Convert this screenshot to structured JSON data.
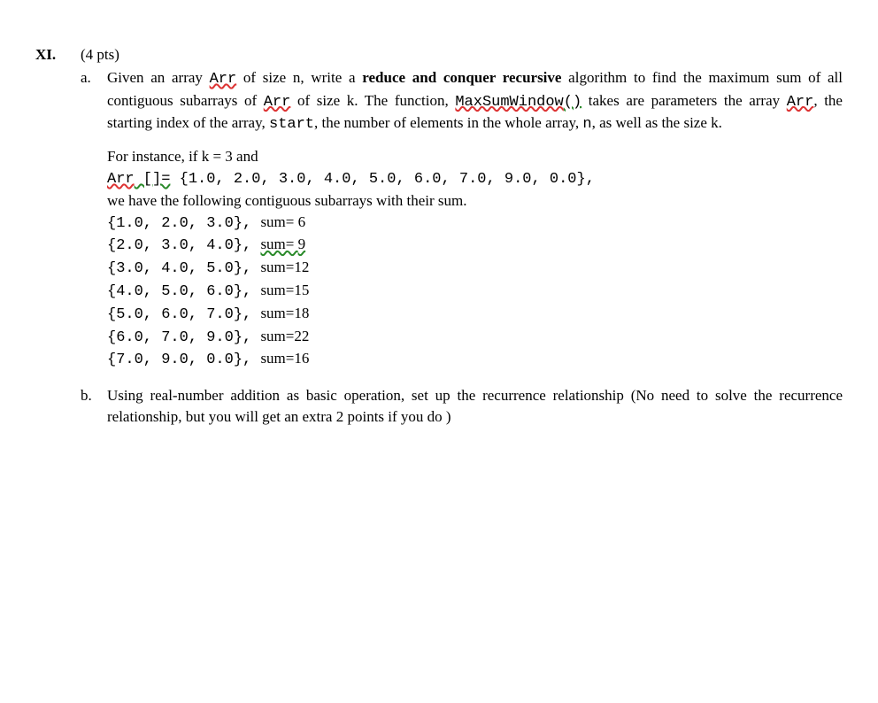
{
  "q_number": "XI.",
  "points": "(4 pts)",
  "a_marker": "a.",
  "b_marker": "b.",
  "a_text": {
    "p1_pre": "Given an array ",
    "arr": "Arr",
    "p1_mid1": " of size n, write a ",
    "bold1": "reduce and conquer recursive",
    "p1_mid2": " algorithm to find the maximum sum of all contiguous subarrays of ",
    "p1_mid3": " of size k. The function, ",
    "func": "MaxSumWindow",
    "paren": "()",
    "p1_mid4": " takes are parameters the array ",
    "p1_mid5": ", the starting index of the array, ",
    "start_code": "start",
    "p1_mid6": ", the number of elements in the whole array, ",
    "n_code": "n",
    "p1_end": ", as well as the size k."
  },
  "example": {
    "intro": "For instance, if k = 3 and",
    "arr_decl_pre": "Arr",
    "arr_decl_eq": " []=",
    "arr_decl_val": "  {1.0, 2.0, 3.0, 4.0, 5.0, 6.0, 7.0, 9.0, 0.0},",
    "following": "we have the following contiguous subarrays with their sum.",
    "lines": [
      {
        "arr": "{1.0, 2.0, 3.0}",
        "sep": ", ",
        "sum_pre": "sum= ",
        "sum_val": "6",
        "squiggle": false
      },
      {
        "arr": "{2.0, 3.0, 4.0}",
        "sep": ", ",
        "sum_pre": "sum= ",
        "sum_val": "9",
        "squiggle": true
      },
      {
        "arr": "{3.0, 4.0, 5.0}",
        "sep": ", ",
        "sum_pre": "sum=",
        "sum_val": "12",
        "squiggle": false
      },
      {
        "arr": "{4.0, 5.0, 6.0}",
        "sep": ", ",
        "sum_pre": "sum=",
        "sum_val": "15",
        "squiggle": false
      },
      {
        "arr": "{5.0, 6.0, 7.0}",
        "sep": ", ",
        "sum_pre": "sum=",
        "sum_val": "18",
        "squiggle": false
      },
      {
        "arr": "{6.0, 7.0, 9.0}",
        "sep": ", ",
        "sum_pre": "sum=",
        "sum_val": "22",
        "squiggle": false
      },
      {
        "arr": "{7.0, 9.0, 0.0}",
        "sep": ", ",
        "sum_pre": "sum=",
        "sum_val": "16",
        "squiggle": false
      }
    ]
  },
  "b_text": "Using real-number addition as basic operation, set up the recurrence relationship (No need to solve the recurrence relationship, but you will get an extra 2 points if you do   )"
}
